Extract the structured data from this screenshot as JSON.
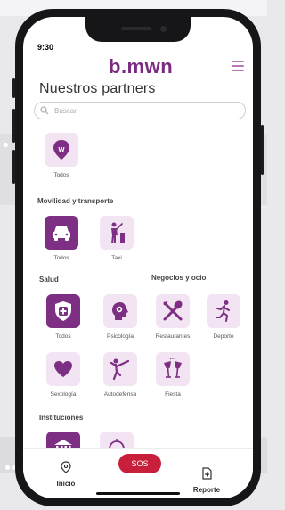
{
  "status": {
    "time": "9:30"
  },
  "header": {
    "brand": "b.mwn",
    "menu_icon": "hamburger-icon"
  },
  "page": {
    "title": "Nuestros partners"
  },
  "search": {
    "placeholder": "Buscar",
    "icon": "search-icon"
  },
  "colors": {
    "primary": "#7d2f83",
    "tile_bg": "#f3e4f4",
    "sos": "#c8203a"
  },
  "categories": {
    "general": {
      "items": [
        {
          "label": "Todos",
          "icon": "bmwn-pin-icon",
          "active": false
        }
      ]
    },
    "movilidad": {
      "title": "Movilidad y transporte",
      "items": [
        {
          "label": "Todos",
          "icon": "car-icon",
          "active": true
        },
        {
          "label": "Taxi",
          "icon": "taxi-hail-icon",
          "active": false
        }
      ]
    },
    "salud": {
      "title": "Salud",
      "items": [
        {
          "label": "Todos",
          "icon": "shield-plus-icon",
          "active": true
        },
        {
          "label": "Psicología",
          "icon": "head-gear-icon",
          "active": false
        },
        {
          "label": "Sexología",
          "icon": "heart-icon",
          "active": false
        },
        {
          "label": "Autodefensa",
          "icon": "martial-arts-icon",
          "active": false
        }
      ]
    },
    "negocios": {
      "title": "Negocios y ocio",
      "items": [
        {
          "label": "Restaurantes",
          "icon": "fork-spoon-icon",
          "active": false
        },
        {
          "label": "Deporte",
          "icon": "runner-icon",
          "active": false
        },
        {
          "label": "Fiesta",
          "icon": "cheers-icon",
          "active": false
        }
      ]
    },
    "instituciones": {
      "title": "Instituciones",
      "items": [
        {
          "label": "",
          "icon": "government-building-icon",
          "active": true
        },
        {
          "label": "",
          "icon": "dome-building-icon",
          "active": false
        }
      ]
    }
  },
  "bottom_nav": {
    "home": {
      "label": "Inicio",
      "icon": "location-pin-icon"
    },
    "sos": {
      "label": "SOS"
    },
    "report": {
      "label": "Reporte",
      "icon": "report-doc-icon"
    }
  }
}
